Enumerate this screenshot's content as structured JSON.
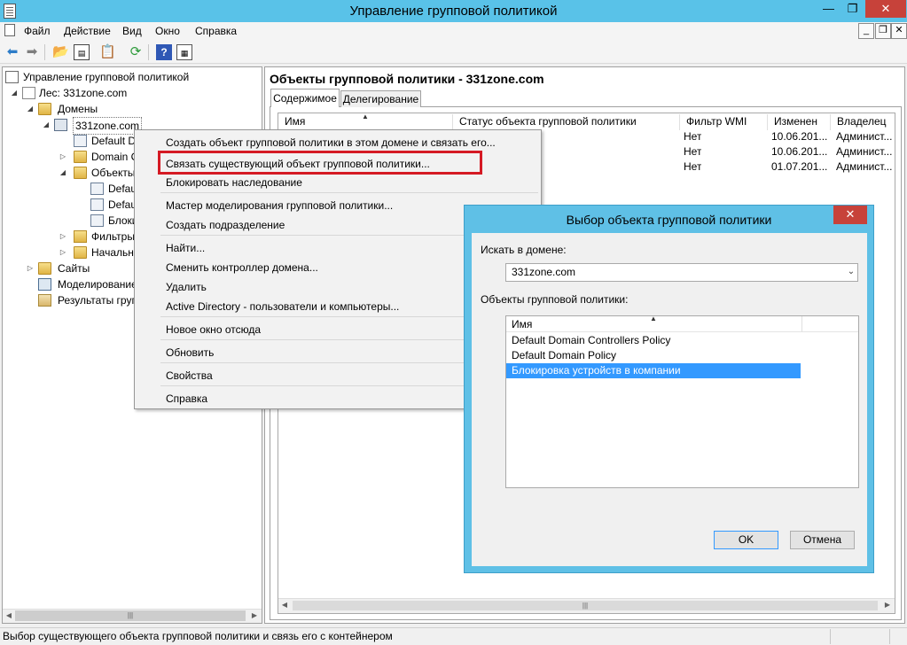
{
  "window": {
    "title": "Управление групповой политикой",
    "min_glyph": "—",
    "max_glyph": "❐",
    "close_glyph": "✕"
  },
  "menu": {
    "items": [
      "Файл",
      "Действие",
      "Вид",
      "Окно",
      "Справка"
    ],
    "mdi_min": "_",
    "mdi_restore": "❐",
    "mdi_close": "✕"
  },
  "toolbar": {
    "icons": [
      "back-arrow-icon",
      "forward-arrow-icon",
      "up-folder-icon",
      "show-hide-tree-icon",
      "clipboard-icon",
      "refresh-icon",
      "help-icon",
      "properties-pane-icon"
    ]
  },
  "tree": {
    "items": [
      {
        "label": "Управление групповой политикой",
        "expander": "",
        "icon": "gpm-root-icon"
      },
      {
        "label": "Лес: 331zone.com",
        "expander": "◢",
        "icon": "forest-icon"
      },
      {
        "label": "Домены",
        "expander": "◢",
        "icon": "domains-folder-icon"
      },
      {
        "label": "331zone.com",
        "expander": "◢",
        "icon": "domain-icon"
      },
      {
        "label": "Default D",
        "expander": "",
        "icon": "gpo-link-icon"
      },
      {
        "label": "Domain C",
        "expander": "▷",
        "icon": "ou-icon"
      },
      {
        "label": "Объекты",
        "expander": "◢",
        "icon": "gpo-folder-icon"
      },
      {
        "label": "Defau",
        "expander": "",
        "icon": "gpo-icon"
      },
      {
        "label": "Defau",
        "expander": "",
        "icon": "gpo-icon"
      },
      {
        "label": "Блоки",
        "expander": "",
        "icon": "gpo-icon"
      },
      {
        "label": "Фильтры",
        "expander": "▷",
        "icon": "wmi-filter-folder-icon"
      },
      {
        "label": "Начальн",
        "expander": "▷",
        "icon": "starter-gpo-folder-icon"
      },
      {
        "label": "Сайты",
        "expander": "▷",
        "icon": "sites-folder-icon"
      },
      {
        "label": "Моделирование",
        "expander": "",
        "icon": "modeling-icon"
      },
      {
        "label": "Результаты груп",
        "expander": "",
        "icon": "results-icon"
      }
    ],
    "scroll_left": "◀",
    "scroll_right": "▶",
    "scroll_grip": "|||"
  },
  "right_pane": {
    "title": "Объекты групповой политики - 331zone.com",
    "tabs": [
      "Содержимое",
      "Делегирование"
    ],
    "columns": [
      "Имя",
      "Статус объекта групповой политики",
      "Фильтр WMI",
      "Изменен",
      "Владелец"
    ],
    "sort_indicator": "▲",
    "rows": [
      {
        "wmi": "Нет",
        "modified": "10.06.201...",
        "owner": "Админист..."
      },
      {
        "wmi": "Нет",
        "modified": "10.06.201...",
        "owner": "Админист..."
      },
      {
        "wmi": "Нет",
        "modified": "01.07.201...",
        "owner": "Админист..."
      }
    ],
    "scroll_left": "◀",
    "scroll_right": "▶",
    "scroll_grip": "|||"
  },
  "context_menu": {
    "items": [
      "Создать объект групповой политики в этом домене и связать его...",
      "Связать существующий объект групповой политики...",
      "Блокировать наследование",
      "Мастер моделирования групповой политики...",
      "Создать подразделение",
      "Найти...",
      "Сменить контроллер домена...",
      "Удалить",
      "Active Directory - пользователи и компьютеры...",
      "Новое окно отсюда",
      "Обновить",
      "Свойства",
      "Справка"
    ],
    "highlight_color": "#d51a24"
  },
  "dialog": {
    "title": "Выбор объекта групповой политики",
    "close_glyph": "✕",
    "search_domain_label": "Искать в домене:",
    "domain_value": "331zone.com",
    "dropdown_glyph": "⌄",
    "gpo_list_label": "Объекты групповой политики:",
    "column_name": "Имя",
    "sort_indicator": "▲",
    "gpos": [
      "Default Domain Controllers Policy",
      "Default Domain Policy",
      "Блокировка устройств в компании"
    ],
    "selected_index": 2,
    "ok_label": "OK",
    "cancel_label": "Отмена"
  },
  "status": {
    "text": "Выбор существующего объекта групповой политики и связь его с контейнером"
  },
  "colors": {
    "titlebar": "#59c2e8",
    "close_button": "#c7423a",
    "selection": "#3399ff"
  }
}
